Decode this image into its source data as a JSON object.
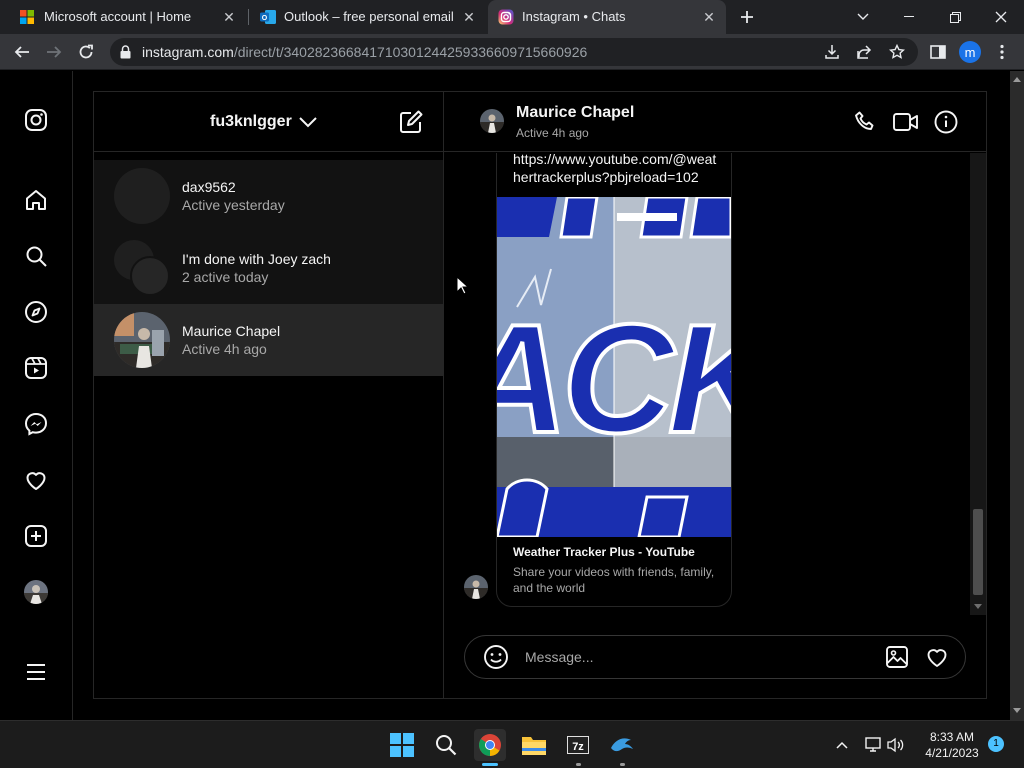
{
  "browser": {
    "tabs": [
      {
        "title": "Microsoft account | Home",
        "icon": "microsoft-logo-icon"
      },
      {
        "title": "Outlook – free personal email and calendar",
        "icon": "outlook-icon"
      },
      {
        "title": "Instagram • Chats",
        "icon": "instagram-icon",
        "active": true
      }
    ],
    "url_host": "instagram.com",
    "url_path": "/direct/t/340282366841710301244259336609715660926",
    "profile_initial": "m"
  },
  "instagram": {
    "inbox": {
      "username": "fu3knlgger",
      "threads": [
        {
          "name": "dax9562",
          "status": "Active yesterday"
        },
        {
          "name": "I'm done with Joey zach",
          "status": "2 active today"
        },
        {
          "name": "Maurice Chapel",
          "status": "Active 4h ago",
          "selected": true
        }
      ]
    },
    "chat": {
      "peer_name": "Maurice Chapel",
      "peer_status": "Active 4h ago",
      "link_text": "https://www.youtube.com/@weathertrackerplus?pbjreload=102",
      "card_title": "Weather Tracker Plus - YouTube",
      "card_description": "Share your videos with friends, family, and the world",
      "thumbnail_text": "ACK",
      "composer_placeholder": "Message..."
    }
  },
  "taskbar": {
    "time": "8:33 AM",
    "date": "4/21/2023",
    "notification_count": "1"
  },
  "colors": {
    "ig_background": "#000000",
    "selected_thread": "#262626",
    "thumbnail_blue": "#1a2fb0"
  }
}
